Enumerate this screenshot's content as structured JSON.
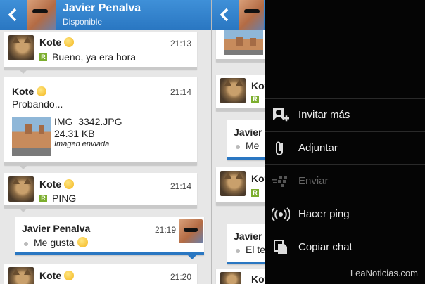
{
  "left_panel": {
    "header": {
      "name": "Javier Penalva",
      "status": "Disponible"
    },
    "messages": [
      {
        "sender": "Kote",
        "time": "21:13",
        "text": "Bueno, ya era hora"
      },
      {
        "sender": "Kote",
        "time": "21:14",
        "text": "Probando...",
        "attachment": {
          "filename": "IMG_3342.JPG",
          "size": "24.31 KB",
          "status": "Imagen enviada"
        }
      },
      {
        "sender": "Kote",
        "time": "21:14",
        "text": "PING"
      },
      {
        "sender": "Javier Penalva",
        "time": "21:19",
        "text": "Me gusta"
      },
      {
        "sender": "Kote",
        "time": "21:20",
        "text": ""
      }
    ]
  },
  "right_panel": {
    "partial_messages": [
      {
        "sender": "Kote"
      },
      {
        "sender": "Javier",
        "text": "Me"
      },
      {
        "sender": "Kote"
      },
      {
        "sender": "Javier",
        "text": "El te"
      },
      {
        "sender": "Kote"
      }
    ],
    "menu": {
      "items": [
        {
          "label": "Invitar más",
          "icon": "invite-contact-icon",
          "enabled": true
        },
        {
          "label": "Adjuntar",
          "icon": "paperclip-icon",
          "enabled": true
        },
        {
          "label": "Enviar",
          "icon": "send-bbm-icon",
          "enabled": false
        },
        {
          "label": "Hacer ping",
          "icon": "ping-icon",
          "enabled": true
        },
        {
          "label": "Copiar chat",
          "icon": "copy-chat-icon",
          "enabled": true
        }
      ]
    }
  },
  "badge_letter": "R",
  "watermark": "LeaNoticias.com",
  "colors": {
    "header": "#2a77c2",
    "outgoing_accent": "#2a77c2",
    "read_badge": "#7cae2e",
    "menu_bg": "#050505"
  }
}
